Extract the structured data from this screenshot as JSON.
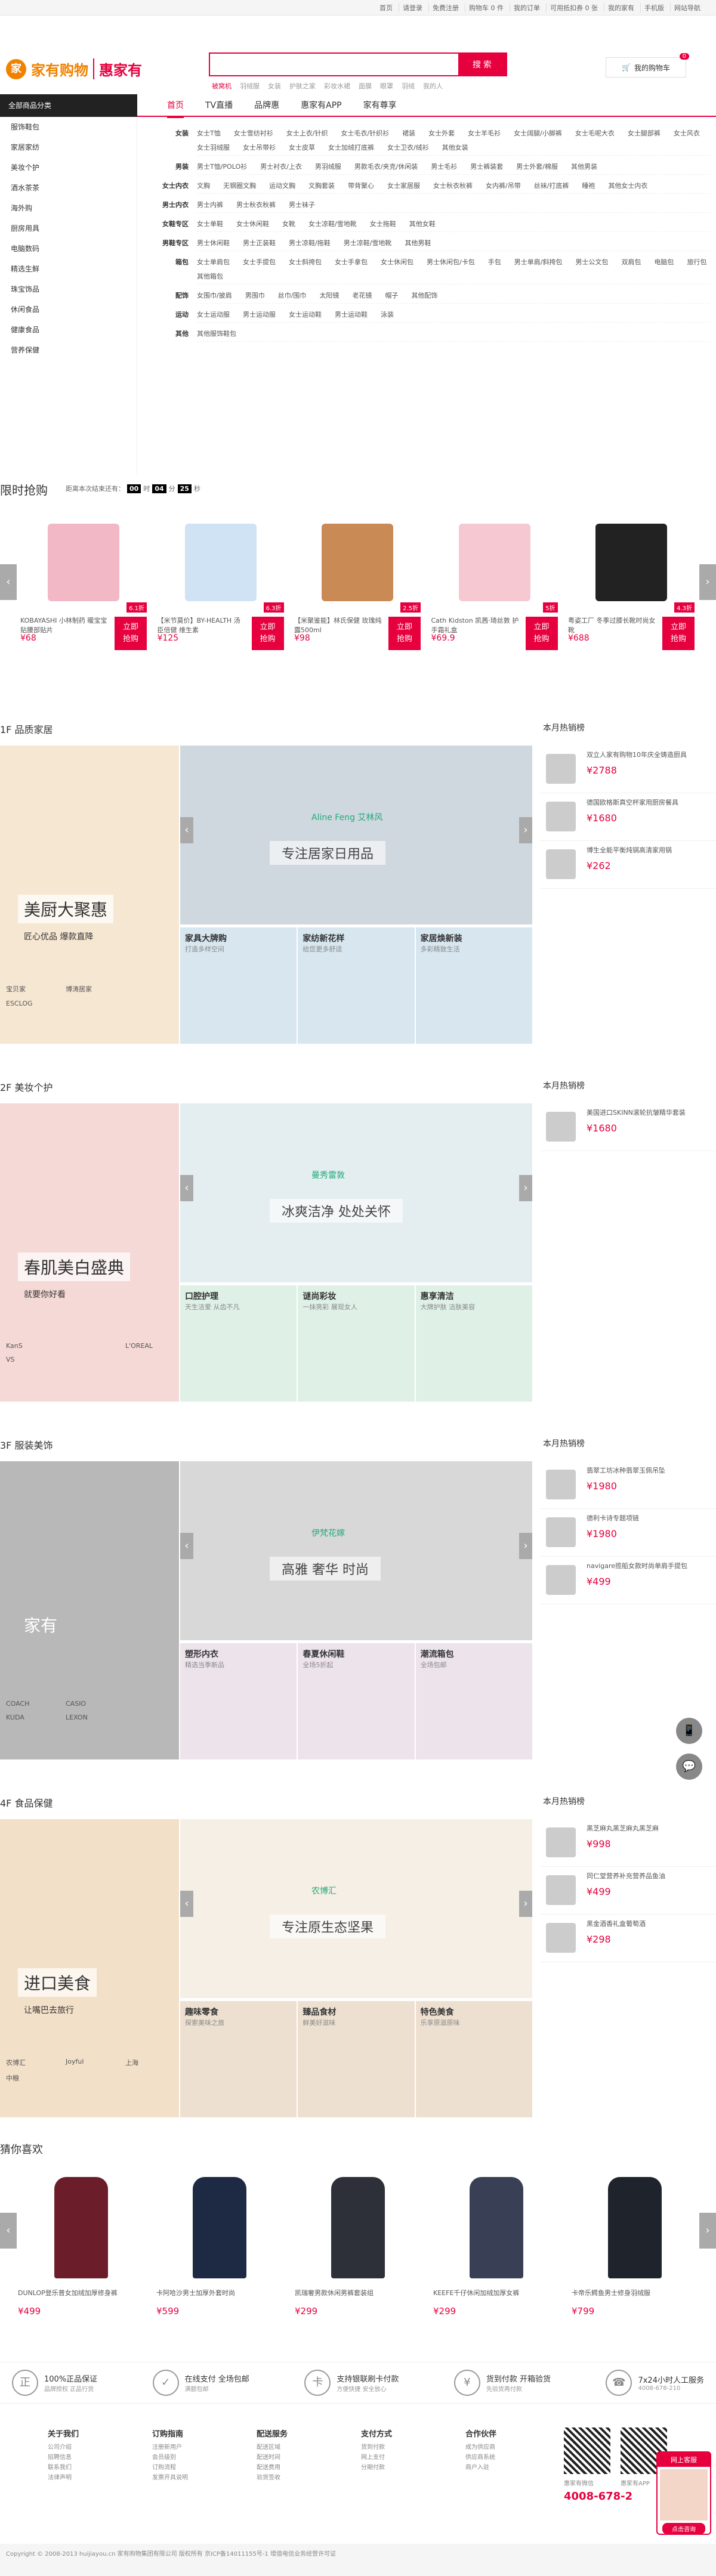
{
  "topbar": {
    "links": [
      "首页",
      "请登录",
      "免费注册",
      "购物车 0 件",
      "我的订单",
      "可用抵扣券 0 张",
      "我的家有",
      "手机版",
      "网站导航"
    ]
  },
  "header": {
    "brand1": "家有购物",
    "brand2": "惠家有",
    "search_placeholder": "",
    "search_button": "搜 索",
    "hotwords": [
      "被窝机",
      "羽绒服",
      "女装",
      "护肤之家",
      "彩妆水裙",
      "面膜",
      "眼罩",
      "羽绒",
      "我的人"
    ],
    "cart_label": "我的购物车",
    "cart_count": "0"
  },
  "nav": {
    "category": "全部商品分类",
    "items": [
      "首页",
      "TV直播",
      "品牌惠",
      "惠家有APP",
      "家有尊享"
    ]
  },
  "sidebar": [
    "服饰鞋包",
    "家居家纺",
    "美妆个护",
    "酒水茶茶",
    "海外购",
    "厨房用具",
    "电脑数码",
    "精选生鲜",
    "珠宝饰品",
    "休闲食品",
    "健康食品",
    "营养保健"
  ],
  "mega": [
    {
      "label": "女装",
      "vals": [
        "女士T恤",
        "女士雪纺衬衫",
        "女士上衣/针织",
        "女士毛衣/针织衫",
        "裙装",
        "女士外套",
        "女士羊毛衫",
        "女士阔腿/小脚裤",
        "女士毛呢大衣",
        "女士腿部裤",
        "女士风衣",
        "女士羽绒服",
        "女士吊带衫",
        "女士皮草",
        "女士加绒打底裤",
        "女士卫衣/绒衫",
        "其他女装"
      ]
    },
    {
      "label": "男装",
      "vals": [
        "男士T恤/POLO衫",
        "男士衬衣/上衣",
        "男羽绒服",
        "男款毛衣/夹克/休闲装",
        "男士毛衫",
        "男士裤装套",
        "男士外套/棉服",
        "其他男装"
      ]
    },
    {
      "label": "女士内衣",
      "vals": [
        "文胸",
        "无钢圈文胸",
        "运动文胸",
        "文胸套装",
        "带背聚心",
        "女士家居服",
        "女士秋衣秋裤",
        "女内裤/吊带",
        "丝袜/打底裤",
        "睡袍",
        "其他女士内衣"
      ]
    },
    {
      "label": "男士内衣",
      "vals": [
        "男士内裤",
        "男士秋衣秋裤",
        "男士袜子"
      ]
    },
    {
      "label": "女鞋专区",
      "vals": [
        "女士单鞋",
        "女士休闲鞋",
        "女靴",
        "女士凉鞋/雪地靴",
        "女士拖鞋",
        "其他女鞋"
      ]
    },
    {
      "label": "男鞋专区",
      "vals": [
        "男士休闲鞋",
        "男士正装鞋",
        "男士凉鞋/拖鞋",
        "男士凉鞋/雪地靴",
        "其他男鞋"
      ]
    },
    {
      "label": "箱包",
      "vals": [
        "女士单肩包",
        "女士手提包",
        "女士斜挎包",
        "女士手拿包",
        "女士休闲包",
        "男士休闲包/卡包",
        "手包",
        "男士单肩/斜挎包",
        "男士公文包",
        "双肩包",
        "电脑包",
        "旅行包",
        "其他箱包"
      ]
    },
    {
      "label": "配饰",
      "vals": [
        "女围巾/披肩",
        "男围巾",
        "丝巾/围巾",
        "太阳镜",
        "老花镜",
        "帽子",
        "其他配饰"
      ]
    },
    {
      "label": "运动",
      "vals": [
        "女士运动服",
        "男士运动服",
        "女士运动鞋",
        "男士运动鞋",
        "泳装"
      ]
    },
    {
      "label": "其他",
      "vals": [
        "其他服饰鞋包"
      ]
    }
  ],
  "flash": {
    "title": "限时抢购",
    "prefix": "距离本次结束还有：",
    "h": "00",
    "m": "04",
    "s": "25",
    "h_unit": "时",
    "m_unit": "分",
    "s_unit": "秒",
    "buy": "立即\n抢购",
    "items": [
      {
        "name": "KOBAYASHI 小林制药 暖宝宝贴腰部贴片",
        "price": "¥68",
        "tag": "6.1折"
      },
      {
        "name": "【米节莫价】BY-HEALTH 汤臣倍健 维生素",
        "price": "¥125",
        "tag": "6.3折"
      },
      {
        "name": "【米聚鉴能】林氏保健 玫瑰纯露500ml",
        "price": "¥98",
        "tag": "2.5折"
      },
      {
        "name": "Cath Kidston 凯茜·琦丝敦 护手霜礼盒",
        "price": "¥69.9",
        "tag": "5折"
      },
      {
        "name": "粤姿工厂 冬季过膝长靴时尚女靴",
        "price": "¥688",
        "tag": "4.3折"
      }
    ]
  },
  "floor1": {
    "title": "1F 品质家居",
    "rank": "本月热销榜",
    "left_t": "美厨大聚惠",
    "left_s": "匠心优品 爆款直降",
    "big": "专注居家日用品",
    "brand": "Aline Feng 艾林风",
    "subs": [
      {
        "a": "家具大牌购",
        "b": "打造多样空间"
      },
      {
        "a": "家纺新花样",
        "b": "给您更多舒适"
      },
      {
        "a": "家居焕新装",
        "b": "多彩精致生活"
      }
    ],
    "logos": [
      "宝贝家",
      "博涛居家",
      "",
      "ESCLOG"
    ],
    "ranks": [
      {
        "t": "双立人家有购物10年庆全铸造厨具",
        "p": "¥2788"
      },
      {
        "t": "德国欧格斯真空杯家用厨房餐具",
        "p": "¥1680"
      },
      {
        "t": "博生全能平衡炖锅高清家用锅",
        "p": "¥262"
      }
    ]
  },
  "floor2": {
    "title": "2F 美妆个护",
    "rank": "本月热销榜",
    "left_t": "春肌美白盛典",
    "left_s": "就要你好看",
    "big": "冰爽洁净 处处关怀",
    "brand": "曼秀雷敦",
    "subs": [
      {
        "a": "口腔护理",
        "b": "天生洁爱 从齿不凡"
      },
      {
        "a": "谜尚彩妆",
        "b": "一抹亮彩 展现女人"
      },
      {
        "a": "惠享清洁",
        "b": "大牌护肤 洁肤美容"
      }
    ],
    "logos": [
      "KanS",
      "",
      "L'OREAL",
      "VS"
    ],
    "ranks": [
      {
        "t": "美国进口SKINN滚轮抗皱精华套装",
        "p": "¥1680"
      }
    ]
  },
  "floor3": {
    "title": "3F 服装美饰",
    "rank": "本月热销榜",
    "left_t": "家有",
    "big": "高雅 奢华 时尚",
    "brand": "伊梵花嫁",
    "subs": [
      {
        "a": "塑形内衣",
        "b": "精选当季新品"
      },
      {
        "a": "春夏休闲鞋",
        "b": "全场5折起"
      },
      {
        "a": "潮流箱包",
        "b": "全场包邮"
      }
    ],
    "logos": [
      "COACH",
      "CASIO",
      "",
      "KUDA",
      "LEXON"
    ],
    "ranks": [
      {
        "t": "翡翠工坊冰种翡翠玉佩吊坠",
        "p": "¥1980"
      },
      {
        "t": "德利卡诗专题项链",
        "p": "¥1980"
      },
      {
        "t": "navigare揽船女款时尚单肩手提包",
        "p": "¥499"
      }
    ]
  },
  "floor4": {
    "title": "4F 食品保健",
    "rank": "本月热销榜",
    "left_t": "进口美食",
    "left_s": "让嘴巴去旅行",
    "big": "专注原生态坚果",
    "brand": "农博汇",
    "subs": [
      {
        "a": "趣味零食",
        "b": "探索美味之旅"
      },
      {
        "a": "臻品食材",
        "b": "鲜美好滋味"
      },
      {
        "a": "特色美食",
        "b": "乐享原滋原味"
      }
    ],
    "logos": [
      "农博汇",
      "Joyful",
      "上海",
      "中粮"
    ],
    "ranks": [
      {
        "t": "黑芝麻丸黑芝麻丸黑芝麻",
        "p": "¥998"
      },
      {
        "t": "同仁堂营养补充营养品鱼油",
        "p": "¥499"
      },
      {
        "t": "黑金酒香礼盒葡萄酒",
        "p": "¥298"
      }
    ]
  },
  "guess": {
    "title": "猜你喜欢",
    "items": [
      {
        "name": "DUNLOP登乐普女加绒加厚修身裤",
        "price": "¥499"
      },
      {
        "name": "卡阿哈沙男士加厚外套时尚",
        "price": "¥599"
      },
      {
        "name": "凯瑞奢男款休闲男裤套装组",
        "price": "¥299"
      },
      {
        "name": "KEEFE千仔休闲加绒加厚女裤",
        "price": "¥299"
      },
      {
        "name": "卡帝乐鳄鱼男士修身羽绒服",
        "price": "¥799"
      }
    ]
  },
  "guar": [
    {
      "ic": "正",
      "a": "100%正品保证",
      "b": "品牌授权 正品行货"
    },
    {
      "ic": "✓",
      "a": "在线支付 全场包邮",
      "b": "满额包邮"
    },
    {
      "ic": "卡",
      "a": "支持银联刷卡付款",
      "b": "方便快捷 安全放心"
    },
    {
      "ic": "¥",
      "a": "货到付款 开箱验货",
      "b": "先验货再付款"
    },
    {
      "ic": "☎",
      "a": "7x24小时人工服务",
      "b": "4008-678-210"
    }
  ],
  "footer": {
    "cols": [
      {
        "h": "关于我们",
        "l": [
          "公司介绍",
          "招聘信息",
          "联系我们",
          "法律声明"
        ]
      },
      {
        "h": "订购指南",
        "l": [
          "注册新用户",
          "会员级别",
          "订购流程",
          "发票开具说明"
        ]
      },
      {
        "h": "配送服务",
        "l": [
          "配送区域",
          "配送时间",
          "配送费用",
          "验货签收"
        ]
      },
      {
        "h": "支付方式",
        "l": [
          "货到付款",
          "网上支付",
          "分期付款"
        ]
      },
      {
        "h": "合作伙伴",
        "l": [
          "成为供应商",
          "供应商系统",
          "商户入驻"
        ]
      }
    ],
    "qr1": "惠家有微信",
    "qr2": "惠家有APP",
    "phone": "4008-678-2",
    "copyright": "Copyright © 2008-2013 huijiayou.cn 家有购物集团有限公司 版权所有 京ICP备14011155号-1 增值电信业务经营许可证"
  },
  "chat": {
    "h": "网上客服",
    "b": "点击咨询"
  }
}
